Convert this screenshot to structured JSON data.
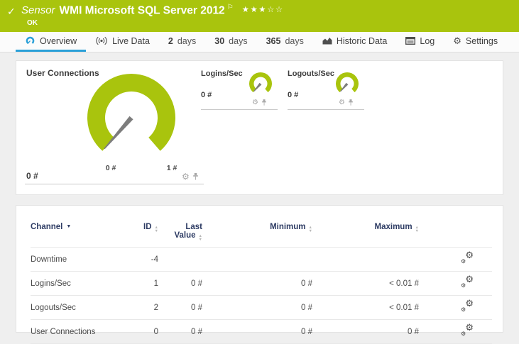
{
  "header": {
    "kind_label": "Sensor",
    "title": "WMI Microsoft SQL Server 2012",
    "status": "OK",
    "flag_icon": "⚐",
    "stars_filled": "★★★",
    "stars_empty": "☆☆",
    "bg_color": "#a9c40d"
  },
  "tabs": {
    "overview": {
      "label": "Overview"
    },
    "live_data": {
      "label": "Live Data"
    },
    "days2": {
      "num": "2",
      "label": "days"
    },
    "days30": {
      "num": "30",
      "label": "days"
    },
    "days365": {
      "num": "365",
      "label": "days"
    },
    "historic": {
      "label": "Historic Data"
    },
    "log": {
      "label": "Log"
    },
    "settings": {
      "label": "Settings"
    },
    "active_color": "#2aa0d8"
  },
  "gauges": {
    "gauge_color": "#a9c40d",
    "needle_color": "#7d7d7d",
    "user_connections": {
      "title": "User Connections",
      "value": "0 #",
      "scale_min": "0 #",
      "scale_max": "1 #"
    },
    "logins": {
      "title": "Logins/Sec",
      "value": "0 #"
    },
    "logouts": {
      "title": "Logouts/Sec",
      "value": "0 #"
    }
  },
  "table": {
    "headers": {
      "channel": "Channel",
      "id": "ID",
      "last1": "Last",
      "last2": "Value",
      "minimum": "Minimum",
      "maximum": "Maximum"
    },
    "rows": [
      {
        "channel": "Downtime",
        "id": "-4",
        "last": "",
        "min": "",
        "max": ""
      },
      {
        "channel": "Logins/Sec",
        "id": "1",
        "last": "0 #",
        "min": "0 #",
        "max": "< 0.01 #"
      },
      {
        "channel": "Logouts/Sec",
        "id": "2",
        "last": "0 #",
        "min": "0 #",
        "max": "< 0.01 #"
      },
      {
        "channel": "User Connections",
        "id": "0",
        "last": "0 #",
        "min": "0 #",
        "max": "0 #"
      }
    ]
  }
}
